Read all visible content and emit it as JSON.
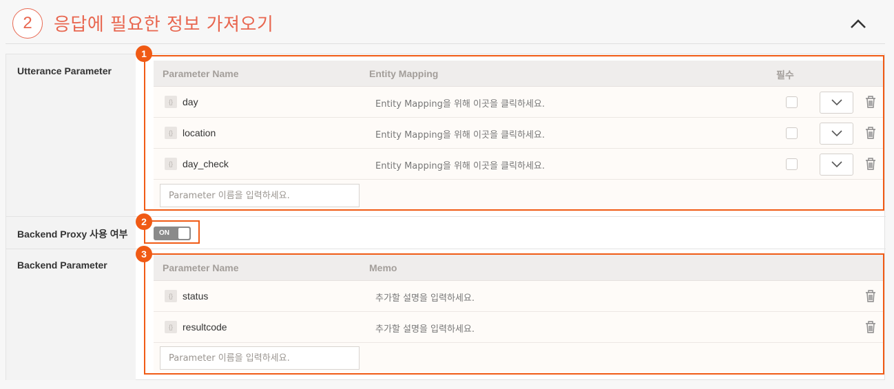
{
  "header": {
    "step_number": "2",
    "title": "응답에 필요한 정보 가져오기",
    "collapse_icon": "chevron-up-icon"
  },
  "utterance": {
    "label": "Utterance Parameter",
    "columns": {
      "name": "Parameter Name",
      "mapping": "Entity Mapping",
      "required": "필수"
    },
    "rows": [
      {
        "name": "day",
        "mapping": "Entity Mapping을 위해 이곳을 클릭하세요."
      },
      {
        "name": "location",
        "mapping": "Entity Mapping을 위해 이곳을 클릭하세요."
      },
      {
        "name": "day_check",
        "mapping": "Entity Mapping을 위해 이곳을 클릭하세요."
      }
    ],
    "add_placeholder": "Parameter 이름을 입력하세요."
  },
  "proxy": {
    "label": "Backend Proxy 사용 여부",
    "toggle_text": "ON"
  },
  "backend": {
    "label": "Backend Parameter",
    "columns": {
      "name": "Parameter Name",
      "memo": "Memo"
    },
    "rows": [
      {
        "name": "status",
        "memo": "추가할 설명을 입력하세요."
      },
      {
        "name": "resultcode",
        "memo": "추가할 설명을 입력하세요."
      }
    ],
    "add_placeholder": "Parameter 이름을 입력하세요."
  },
  "annotations": [
    "1",
    "2",
    "3"
  ],
  "colors": {
    "accent": "#e8664f",
    "annotation": "#f05a14"
  }
}
